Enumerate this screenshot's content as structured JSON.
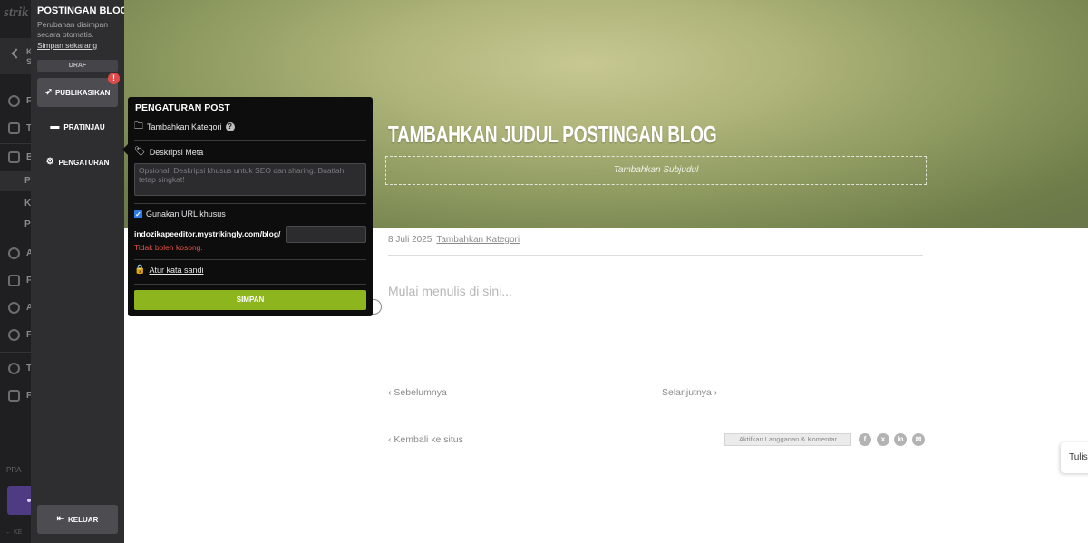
{
  "app_rail": {
    "brand": "strik",
    "back_line1": "K",
    "back_line2": "S",
    "items": [
      "F",
      "T",
      "B",
      "A",
      "F",
      "A",
      "F",
      "T",
      "F"
    ],
    "subitems": [
      "P",
      "K",
      "P"
    ],
    "search_hint": "PRA",
    "footer_hint": "← KE"
  },
  "blog_panel": {
    "title": "POSTINGAN BLOG",
    "autosave_note": "Perubahan disimpan secara otomatis.",
    "save_now_link": "Simpan sekarang",
    "draft_badge": "DRAF",
    "publish_button": "PUBLIKASIKAN",
    "publish_alert": "!",
    "preview_button": "PRATINJAU",
    "settings_button": "PENGATURAN",
    "logout_button": "KELUAR"
  },
  "post_settings": {
    "title": "PENGATURAN POST",
    "add_category_link": "Tambahkan Kategori",
    "meta_description_label": "Deskripsi Meta",
    "meta_description_placeholder": "Opsional. Deskripsi khusus untuk SEO dan sharing. Buatlah tetap singkat!",
    "custom_url_label": "Gunakan URL khusus",
    "custom_url_checked": true,
    "url_prefix": "indozikapeeditor.mystrikingly.com/blog/",
    "url_value": "",
    "url_error": "Tidak boleh kosong.",
    "password_link": "Atur kata sandi",
    "save_button": "SIMPAN"
  },
  "hero": {
    "title": "TAMBAHKAN JUDUL POSTINGAN BLOG",
    "subtitle_placeholder": "Tambahkan Subjudul"
  },
  "post": {
    "date": "8 Juli 2025",
    "add_category": "Tambahkan Kategori",
    "body_placeholder": "Mulai menulis di sini...",
    "prev_link": "Sebelumnya",
    "next_link": "Selanjutnya",
    "back_link": "Kembali ke situs",
    "subscribe_button": "Aktifkan Langganan & Komentar",
    "share_icons": [
      "facebook-icon",
      "x-icon",
      "linkedin-icon",
      "email-icon"
    ],
    "share_glyphs": [
      "f",
      "x",
      "in",
      "✉"
    ]
  },
  "tulis_tab": "Tulis",
  "colors": {
    "save_green": "#8db51e",
    "error_red": "#e3544c",
    "alert_red": "#e24a4a",
    "panel_dark": "#2e2e31",
    "popover_bg": "#0d0d0e"
  }
}
